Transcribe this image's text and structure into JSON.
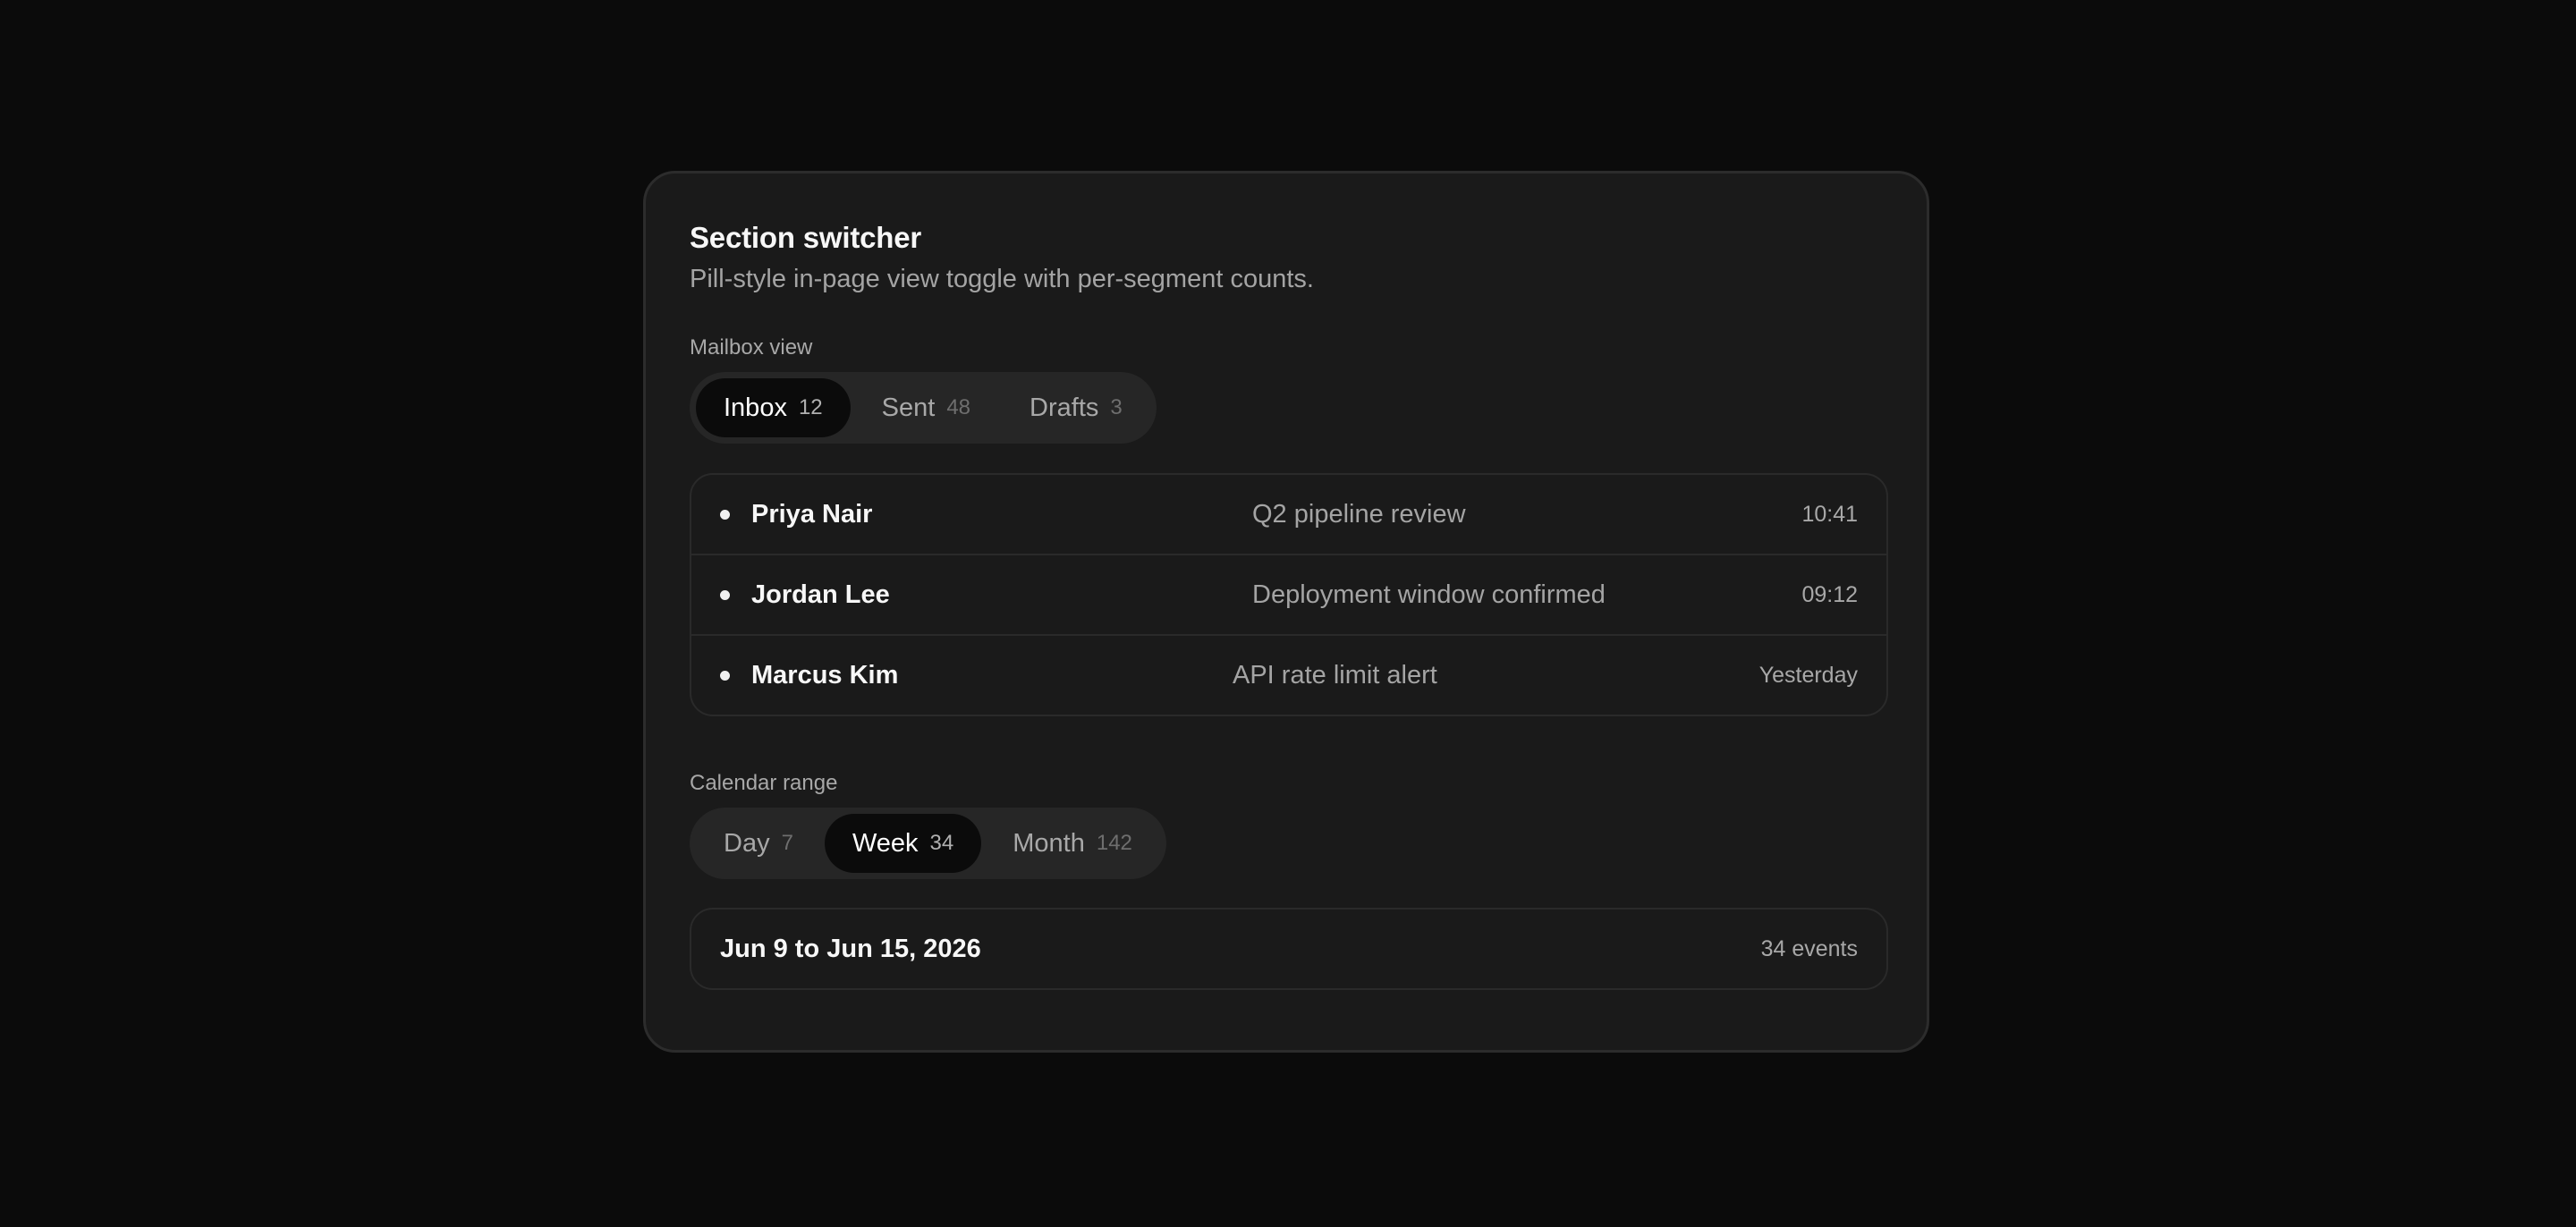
{
  "card": {
    "title": "Section switcher",
    "subtitle": "Pill-style in-page view toggle with per-segment counts."
  },
  "mailbox": {
    "label": "Mailbox view",
    "tabs": [
      {
        "label": "Inbox",
        "count": "12",
        "active": true
      },
      {
        "label": "Sent",
        "count": "48",
        "active": false
      },
      {
        "label": "Drafts",
        "count": "3",
        "active": false
      }
    ],
    "messages": [
      {
        "sender": "Priya Nair",
        "subject": "Q2 pipeline review",
        "time": "10:41"
      },
      {
        "sender": "Jordan Lee",
        "subject": "Deployment window confirmed",
        "time": "09:12"
      },
      {
        "sender": "Marcus Kim",
        "subject": "API rate limit alert",
        "time": "Yesterday"
      }
    ]
  },
  "calendar": {
    "label": "Calendar range",
    "tabs": [
      {
        "label": "Day",
        "count": "7",
        "active": false
      },
      {
        "label": "Week",
        "count": "34",
        "active": true
      },
      {
        "label": "Month",
        "count": "142",
        "active": false
      }
    ],
    "range": "Jun 9 to Jun 15, 2026",
    "events": "34 events"
  },
  "colors": {
    "page_background": "#0b0b0b",
    "card_background": "#1a1a1a",
    "active_pill": "#0b0b0b",
    "pill_track": "#262626"
  }
}
